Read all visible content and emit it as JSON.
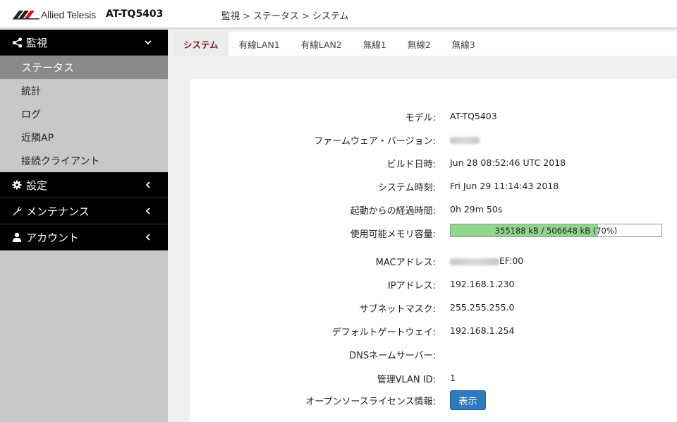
{
  "header": {
    "brand": "Allied Telesis",
    "model": "AT-TQ5403",
    "breadcrumb": [
      "監視",
      "ステータス",
      "システム"
    ],
    "breadcrumb_sep": ">"
  },
  "sidebar": {
    "groups": [
      {
        "label": "監視",
        "icon": "share-icon",
        "expanded": true,
        "items": [
          {
            "label": "ステータス",
            "active": true
          },
          {
            "label": "統計"
          },
          {
            "label": "ログ"
          },
          {
            "label": "近隣AP"
          },
          {
            "label": "接続クライアント"
          }
        ]
      },
      {
        "label": "設定",
        "icon": "gear-icon",
        "expanded": false
      },
      {
        "label": "メンテナンス",
        "icon": "wrench-icon",
        "expanded": false
      },
      {
        "label": "アカウント",
        "icon": "user-icon",
        "expanded": false
      }
    ]
  },
  "tabs": [
    {
      "label": "システム",
      "active": true
    },
    {
      "label": "有線LAN1"
    },
    {
      "label": "有線LAN2"
    },
    {
      "label": "無線1"
    },
    {
      "label": "無線2"
    },
    {
      "label": "無線3"
    }
  ],
  "info": {
    "model_label": "モデル:",
    "model_value": "AT-TQ5403",
    "firmware_label": "ファームウェア・バージョン:",
    "build_label": "ビルド日時:",
    "build_value": "Jun 28 08:52:46 UTC 2018",
    "systime_label": "システム時刻:",
    "systime_value": "Fri Jun 29 11:14:43 2018",
    "uptime_label": "起動からの経過時間:",
    "uptime_value": "0h 29m 50s",
    "memory_label": "使用可能メモリ容量:",
    "memory_text": "355188 kB / 506648 kB (70%)",
    "memory_percent": 70,
    "mac_label": "MACアドレス:",
    "mac_suffix": "EF:00",
    "ip_label": "IPアドレス:",
    "ip_value": "192.168.1.230",
    "subnet_label": "サブネットマスク:",
    "subnet_value": "255.255.255.0",
    "gateway_label": "デフォルトゲートウェイ:",
    "gateway_value": "192.168.1.254",
    "dns_label": "DNSネームサーバー:",
    "dns_value": "",
    "vlan_label": "管理VLAN ID:",
    "vlan_value": "1",
    "oss_label": "オープンソースライセンス情報:",
    "oss_button": "表示"
  },
  "colors": {
    "accent_button": "#2f7abf",
    "memory_fill": "#8fd68f",
    "active_tab_text": "#7a1f1f",
    "sidebar_dark": "#000000",
    "sidebar_active": "#8a8a8a"
  }
}
